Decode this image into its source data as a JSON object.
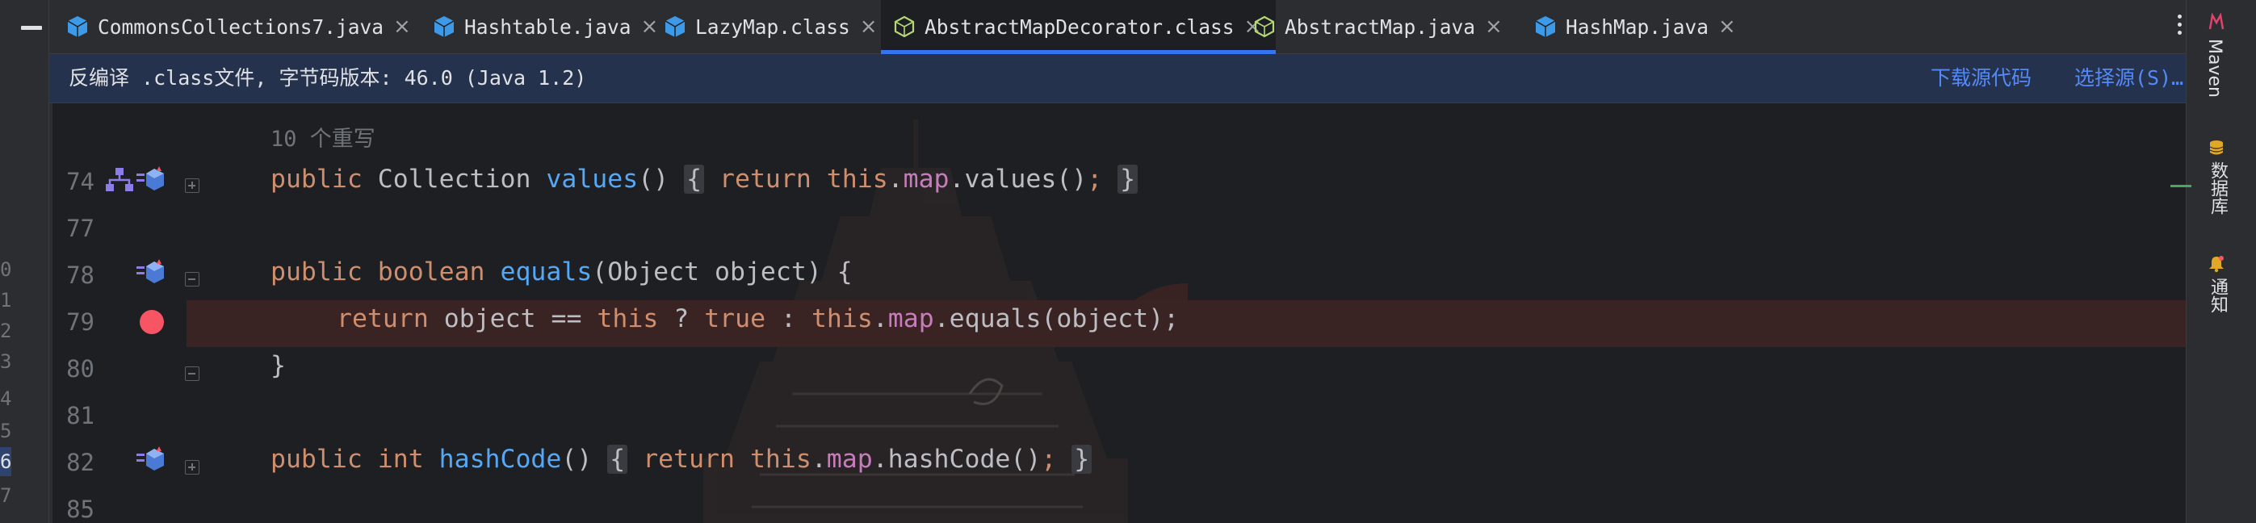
{
  "tabs": [
    {
      "label": "CommonsCollections7.java",
      "icon": "java-class-icon",
      "active": false
    },
    {
      "label": "Hashtable.java",
      "icon": "java-class-icon",
      "active": false
    },
    {
      "label": "LazyMap.class",
      "icon": "java-class-icon",
      "active": false
    },
    {
      "label": "AbstractMapDecorator.class",
      "icon": "abstract-class-icon",
      "active": true
    },
    {
      "label": "AbstractMap.java",
      "icon": "abstract-class-icon",
      "active": false
    },
    {
      "label": "HashMap.java",
      "icon": "java-class-icon",
      "active": false
    }
  ],
  "close_glyph": "×",
  "banner": {
    "message": "反编译 .class文件, 字节码版本: 46.0 (Java 1.2)",
    "download_source": "下载源代码",
    "choose_source": "选择源(S)…"
  },
  "editor": {
    "inlay_hint": "10 个重写",
    "lines": [
      {
        "number": "74",
        "tokens": {
          "t1": "public",
          "t2": "Collection",
          "t3": "values",
          "t4": "()",
          "t5": "{",
          "t6": "return",
          "t7": "this",
          "t8": ".",
          "t9": "map",
          "t10": ".values()",
          "t11": ";",
          "t12": "}"
        }
      },
      {
        "number": "77"
      },
      {
        "number": "78",
        "tokens": {
          "t1": "public",
          "t2": "boolean",
          "t3": "equals",
          "t4": "(Object object) {"
        }
      },
      {
        "number": "79",
        "tokens": {
          "t1": "return",
          "t2": "object ==",
          "t3": "this",
          "t4": "?",
          "t5": "true",
          "t6": ":",
          "t7": "this",
          "t8": ".",
          "t9": "map",
          "t10": ".equals(object);"
        }
      },
      {
        "number": "80",
        "tokens": {
          "t1": "}"
        }
      },
      {
        "number": "81"
      },
      {
        "number": "82",
        "tokens": {
          "t1": "public",
          "t2": "int",
          "t3": "hashCode",
          "t4": "()",
          "t5": "{",
          "t6": "return",
          "t7": "this",
          "t8": ".",
          "t9": "map",
          "t10": ".hashCode()",
          "t11": ";",
          "t12": "}"
        }
      },
      {
        "number": "85"
      }
    ]
  },
  "left_gutter_digits": [
    "0",
    "1",
    "2",
    "3",
    "4",
    "5",
    "6",
    "7"
  ],
  "right_toolbar": {
    "maven": "Maven",
    "database": "数据库",
    "notifications": "通知"
  },
  "colors": {
    "keyword": "#cf8e6d",
    "method": "#56a8f5",
    "field": "#c77dbb",
    "breakpoint": "#f75464",
    "accent": "#3574f0"
  }
}
